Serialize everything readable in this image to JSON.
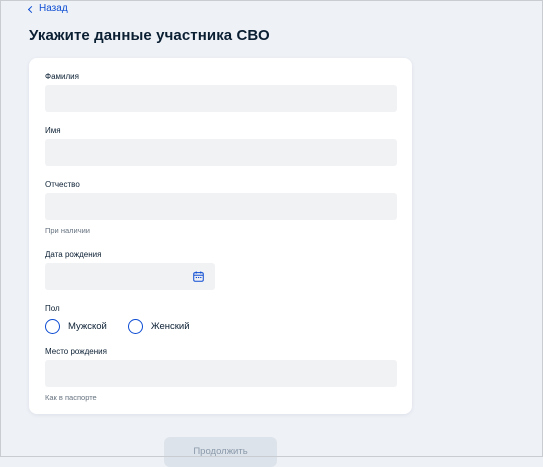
{
  "nav": {
    "back_label": "Назад"
  },
  "page": {
    "title": "Укажите данные участника СВО"
  },
  "form": {
    "last_name": {
      "label": "Фамилия",
      "value": ""
    },
    "first_name": {
      "label": "Имя",
      "value": ""
    },
    "patronymic": {
      "label": "Отчество",
      "value": "",
      "hint": "При наличии"
    },
    "birth_date": {
      "label": "Дата рождения",
      "value": "",
      "icon": "calendar-icon"
    },
    "gender": {
      "label": "Пол",
      "options": [
        {
          "label": "Мужской",
          "selected": false
        },
        {
          "label": "Женский",
          "selected": false
        }
      ]
    },
    "birth_place": {
      "label": "Место рождения",
      "value": "",
      "hint": "Как в паспорте"
    }
  },
  "actions": {
    "continue_label": "Продолжить"
  },
  "colors": {
    "accent": "#0d4cd3",
    "background": "#eef2f7",
    "input_bg": "#f1f2f4",
    "text": "#0b1f33",
    "hint": "#66727f"
  }
}
